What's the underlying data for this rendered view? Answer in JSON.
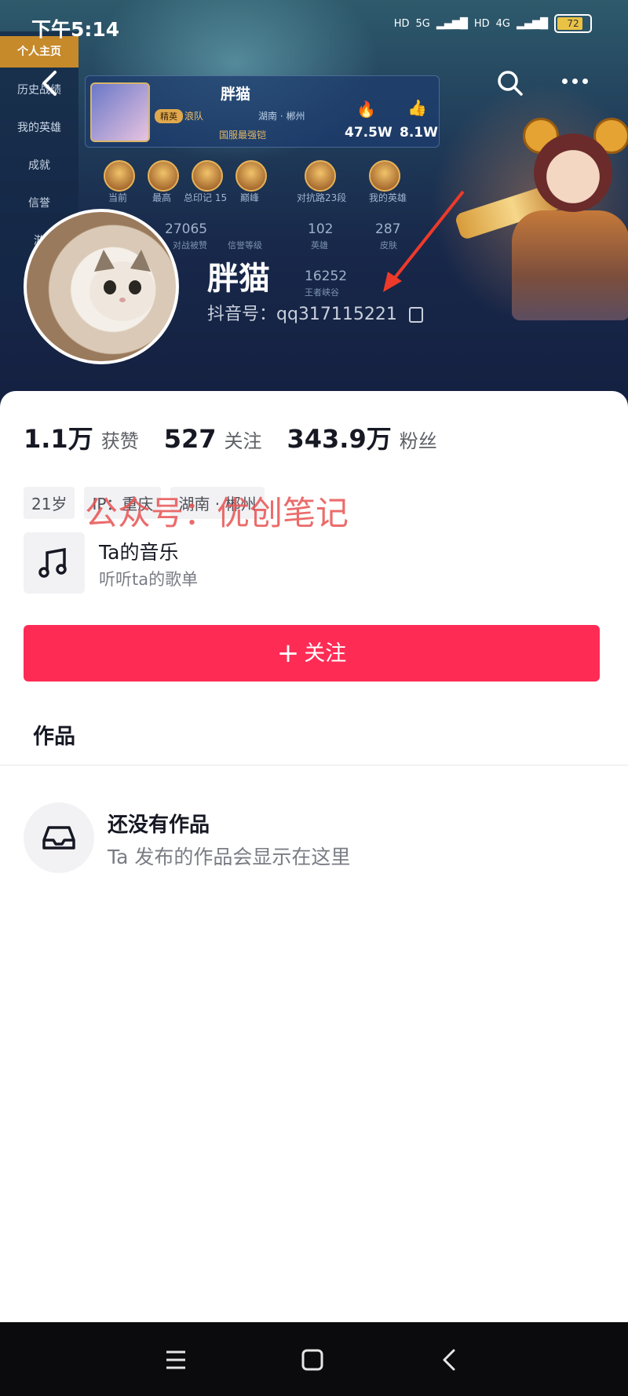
{
  "status_bar": {
    "time": "下午5:14",
    "network1": "5G",
    "network2": "4G",
    "battery": "72"
  },
  "game_card": {
    "side_tabs": [
      "个人主页",
      "历史战绩",
      "我的英雄",
      "成就",
      "信誉",
      "游"
    ],
    "name": "胖猫",
    "tier_tag": "精英",
    "team": "浪队",
    "location": "湖南 · 郴州",
    "rank_title": "国服最强铠",
    "heat": "47.5W",
    "likes": "8.1W",
    "medals": [
      "当前",
      "最高",
      "总印记 15",
      "巅峰",
      "对抗路23段",
      "我的英雄"
    ],
    "stats_row": [
      {
        "num": "27065",
        "label": "对战被赞"
      },
      {
        "num": "",
        "label": "信誉等级"
      },
      {
        "num": "102",
        "label": "英雄"
      },
      {
        "num": "287",
        "label": "皮肤"
      },
      {
        "num": "16252",
        "label": "王者峡谷"
      }
    ]
  },
  "profile": {
    "username": "胖猫",
    "douyin_id": "抖音号：qq317115221"
  },
  "stats": [
    {
      "value": "1.1万",
      "label": "获赞"
    },
    {
      "value": "527",
      "label": "关注"
    },
    {
      "value": "343.9万",
      "label": "粉丝"
    }
  ],
  "chips": [
    "21岁",
    "IP：重庆",
    "湖南 · 郴州"
  ],
  "watermark": "公众号：优创笔记",
  "music": {
    "title": "Ta的音乐",
    "subtitle": "听听ta的歌单"
  },
  "follow_button": "关注",
  "works_tab": "作品",
  "empty_state": {
    "title": "还没有作品",
    "subtitle": "Ta 发布的作品会显示在这里"
  },
  "colors": {
    "accent": "#fe2c55",
    "watermark": "#e85252",
    "banner": "#1f3a58"
  },
  "icons": [
    "back-icon",
    "search-icon",
    "more-icon",
    "copy-icon",
    "music-note-icon",
    "inbox-icon",
    "menu-icon",
    "home-icon",
    "nav-back-icon"
  ]
}
